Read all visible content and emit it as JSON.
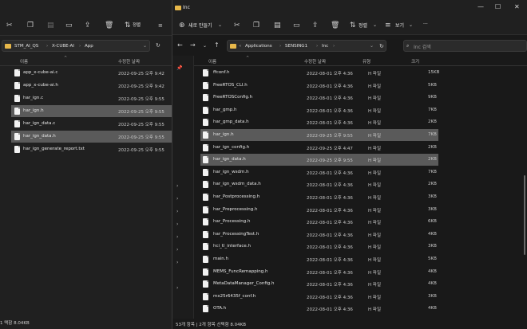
{
  "back_window": {
    "breadcrumb": [
      "STM_AI_QS",
      "X-CUBE-AI",
      "App"
    ],
    "toolbar_sort_label": "정렬",
    "columns": {
      "name": "이름",
      "modified": "수정한 날짜"
    },
    "files": [
      {
        "name": "app_x-cube-ai.c",
        "modified": "2022-09-25 오후 9:42",
        "selected": false
      },
      {
        "name": "app_x-cube-ai.h",
        "modified": "2022-09-25 오후 9:42",
        "selected": false
      },
      {
        "name": "har_ign.c",
        "modified": "2022-09-25 오후 9:55",
        "selected": false
      },
      {
        "name": "har_ign.h",
        "modified": "2022-09-25 오후 9:55",
        "selected": true
      },
      {
        "name": "har_ign_data.c",
        "modified": "2022-09-25 오후 9:55",
        "selected": false
      },
      {
        "name": "har_ign_data.h",
        "modified": "2022-09-25 오후 9:55",
        "selected": true
      },
      {
        "name": "har_ign_generate_report.txt",
        "modified": "2022-09-25 오후 9:55",
        "selected": false
      }
    ],
    "status": "1 택함 8.04KB"
  },
  "front_window": {
    "title": "Inc",
    "toolbar": {
      "new_label": "새로 만들기",
      "sort_label": "정렬",
      "view_label": "보기",
      "more_label": "···"
    },
    "breadcrumb": [
      "«",
      "Applications",
      "SENSING1",
      "Inc"
    ],
    "search_placeholder": "Inc 검색",
    "columns": {
      "name": "이름",
      "modified": "수정한 날짜",
      "type": "유형",
      "size": "크기"
    },
    "files": [
      {
        "name": "ffconf.h",
        "modified": "2022-08-01 오후 4:36",
        "type": "H 파일",
        "size": "15KB",
        "selected": false
      },
      {
        "name": "FreeRTOS_CLI.h",
        "modified": "2022-08-01 오후 4:36",
        "type": "H 파일",
        "size": "5KB",
        "selected": false
      },
      {
        "name": "FreeRTOSConfig.h",
        "modified": "2022-08-01 오후 4:36",
        "type": "H 파일",
        "size": "9KB",
        "selected": false
      },
      {
        "name": "har_gmp.h",
        "modified": "2022-08-01 오후 4:36",
        "type": "H 파일",
        "size": "7KB",
        "selected": false
      },
      {
        "name": "har_gmp_data.h",
        "modified": "2022-08-01 오후 4:36",
        "type": "H 파일",
        "size": "2KB",
        "selected": false
      },
      {
        "name": "har_ign.h",
        "modified": "2022-09-25 오후 9:55",
        "type": "H 파일",
        "size": "7KB",
        "selected": true
      },
      {
        "name": "har_ign_config.h",
        "modified": "2022-09-25 오후 4:47",
        "type": "H 파일",
        "size": "2KB",
        "selected": false
      },
      {
        "name": "har_ign_data.h",
        "modified": "2022-09-25 오후 9:55",
        "type": "H 파일",
        "size": "2KB",
        "selected": true
      },
      {
        "name": "har_ign_wsdm.h",
        "modified": "2022-08-01 오후 4:36",
        "type": "H 파일",
        "size": "7KB",
        "selected": false
      },
      {
        "name": "har_ign_wsdm_data.h",
        "modified": "2022-08-01 오후 4:36",
        "type": "H 파일",
        "size": "2KB",
        "selected": false
      },
      {
        "name": "har_Postprocessing.h",
        "modified": "2022-08-01 오후 4:36",
        "type": "H 파일",
        "size": "3KB",
        "selected": false
      },
      {
        "name": "har_Preprocessing.h",
        "modified": "2022-08-01 오후 4:36",
        "type": "H 파일",
        "size": "3KB",
        "selected": false
      },
      {
        "name": "har_Processing.h",
        "modified": "2022-08-01 오후 4:36",
        "type": "H 파일",
        "size": "6KB",
        "selected": false
      },
      {
        "name": "har_ProcessingTest.h",
        "modified": "2022-08-01 오후 4:36",
        "type": "H 파일",
        "size": "4KB",
        "selected": false
      },
      {
        "name": "hci_tl_interface.h",
        "modified": "2022-08-01 오후 4:36",
        "type": "H 파일",
        "size": "3KB",
        "selected": false
      },
      {
        "name": "main.h",
        "modified": "2022-08-01 오후 4:36",
        "type": "H 파일",
        "size": "5KB",
        "selected": false
      },
      {
        "name": "MEMS_FuncRemapping.h",
        "modified": "2022-08-01 오후 4:36",
        "type": "H 파일",
        "size": "4KB",
        "selected": false
      },
      {
        "name": "MetaDataManager_Config.h",
        "modified": "2022-08-01 오후 4:36",
        "type": "H 파일",
        "size": "4KB",
        "selected": false
      },
      {
        "name": "mx25r6435f_conf.h",
        "modified": "2022-08-01 오후 4:36",
        "type": "H 파일",
        "size": "3KB",
        "selected": false
      },
      {
        "name": "OTA.h",
        "modified": "2022-08-01 오후 4:36",
        "type": "H 파일",
        "size": "4KB",
        "selected": false
      }
    ],
    "status": "53개 항목 | 2개 항목 선택함 8.04KB"
  }
}
